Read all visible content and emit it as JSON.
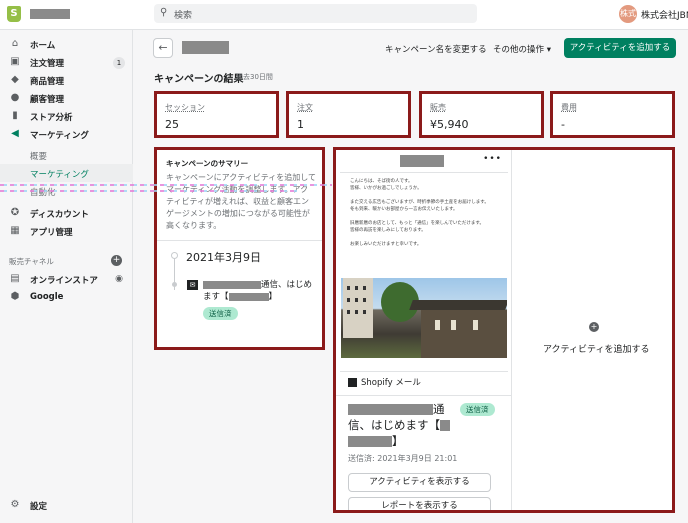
{
  "topbar": {
    "search_placeholder": "検索",
    "avatar_text": "株式",
    "store_name": "株式会社JBN"
  },
  "sidebar": {
    "items": [
      {
        "label": "ホーム",
        "icon": "home-icon"
      },
      {
        "label": "注文管理",
        "icon": "orders-icon",
        "badge": "1"
      },
      {
        "label": "商品管理",
        "icon": "tag-icon"
      },
      {
        "label": "顧客管理",
        "icon": "customer-icon"
      },
      {
        "label": "ストア分析",
        "icon": "analytics-icon"
      },
      {
        "label": "マーケティング",
        "icon": "marketing-icon"
      }
    ],
    "sub_items": [
      "概要",
      "マーケティング",
      "自動化"
    ],
    "items2": [
      {
        "label": "ディスカウント",
        "icon": "discount-icon"
      },
      {
        "label": "アプリ管理",
        "icon": "apps-icon"
      }
    ],
    "channel_section": "販売チャネル",
    "channels": [
      {
        "label": "オンラインストア",
        "icon": "store-icon"
      },
      {
        "label": "Google",
        "icon": "google-icon"
      }
    ],
    "settings": "設定"
  },
  "header": {
    "rename": "キャンペーン名を変更する",
    "more": "その他の操作",
    "add_activity": "アクティビティを追加する"
  },
  "results": {
    "title": "キャンペーンの結果",
    "period": "過去30日間",
    "metrics": [
      {
        "label": "セッション",
        "value": "25"
      },
      {
        "label": "注文",
        "value": "1"
      },
      {
        "label": "販売",
        "value": "¥5,940"
      },
      {
        "label": "費用",
        "value": "-"
      }
    ]
  },
  "summary": {
    "title": "キャンペーンのサマリー",
    "desc": "キャンペーンにアクティビティを追加してマーケティング活動を調整します。アクティビティが増えれば、収益と顧客エンゲージメントの増加につながる可能性が高くなります。",
    "date": "2021年3月9日",
    "email_title_part1": "通信、はじめ",
    "email_title_part2": "ます【",
    "email_title_part3": "】",
    "status": "送信済"
  },
  "email": {
    "preview_lines": [
      "こんにちは、そば街の人です。",
      "皆様、いかがお過ごしでしょうか。",
      "",
      "また交える広告もございますが、時折季節の手土産をお届けします。",
      "冬も到来、暖かいお部屋から一言お伝えいたします。",
      "",
      "旧暦新暦のお店として、もっと「通信」を楽しんでいただけます。",
      "皆様の再訪を楽しみにしております。",
      "",
      "お楽しみいただけますと幸いです。"
    ],
    "channel": "Shopify メール",
    "status": "送信済",
    "subject_part1": "通",
    "subject_part2": "信、はじめます【",
    "subject_part3": "】",
    "sent_at": "送信済: 2021年3月9日 21:01",
    "view_activity": "アクティビティを表示する",
    "view_report": "レポートを表示する"
  },
  "add_activity_card": {
    "label": "アクティビティを追加する"
  }
}
